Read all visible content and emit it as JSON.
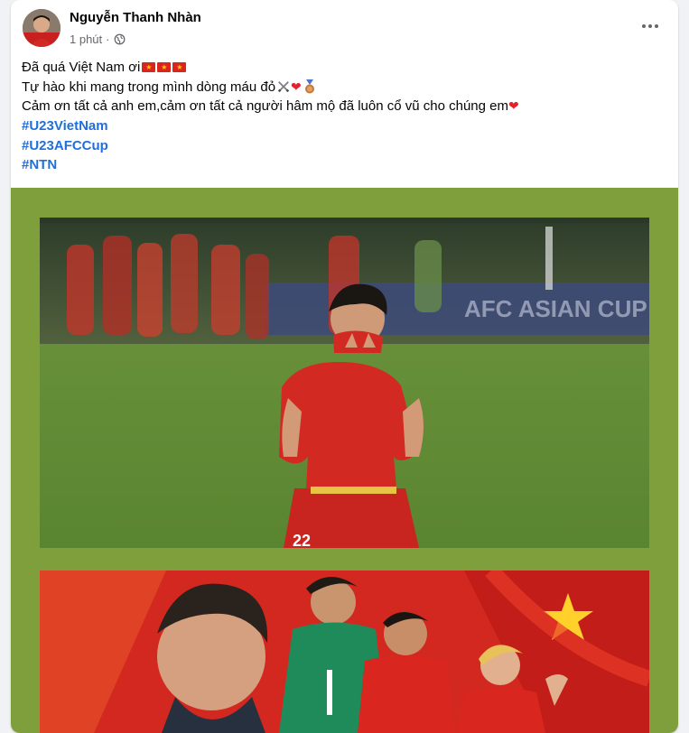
{
  "post": {
    "author": "Nguyễn Thanh Nhàn",
    "time": "1 phút",
    "lines": [
      "Đã quá Việt Nam ơi",
      "Tự hào khi mang trong mình dòng máu đỏ",
      "Cảm ơn tất cả anh em,cảm ơn tất cả người hâm mộ đã luôn cổ vũ cho chúng em"
    ],
    "hashtags": [
      "#U23VietNam",
      "#U23AFCCup",
      "#NTN"
    ],
    "banner_text": "AFC ASIAN CUP",
    "jersey_number": "22"
  },
  "colors": {
    "media_background": "#7e9f3c",
    "hashtag": "#216fdb",
    "vietnam_red": "#da251d",
    "vietnam_yellow": "#ffcd00"
  },
  "icons": [
    "globe-icon",
    "more-options-icon",
    "vietnam-flag-icon",
    "crossed-swords-icon",
    "red-heart-icon",
    "bronze-medal-icon"
  ]
}
